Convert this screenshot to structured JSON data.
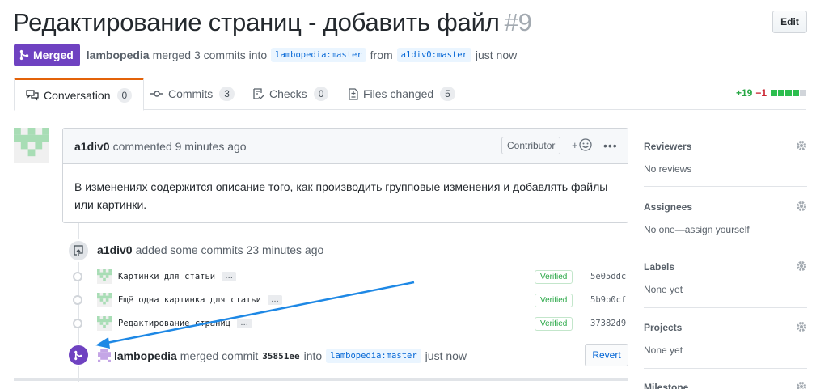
{
  "pr": {
    "title": "Редактирование страниц - добавить файл",
    "number": "#9",
    "edit_label": "Edit",
    "state_label": "Merged",
    "author": "lambopedia",
    "merge_text": "merged 3 commits into",
    "base_branch": "lambopedia:master",
    "from_text": "from",
    "head_branch": "a1div0:master",
    "time_text": "just now"
  },
  "tabs": [
    {
      "label": "Conversation",
      "count": "0"
    },
    {
      "label": "Commits",
      "count": "3"
    },
    {
      "label": "Checks",
      "count": "0"
    },
    {
      "label": "Files changed",
      "count": "5"
    }
  ],
  "diffstat": {
    "additions": "+19",
    "deletions": "−1"
  },
  "comment": {
    "author": "a1div0",
    "action": "commented 9 minutes ago",
    "badge": "Contributor",
    "body": "В изменениях содержится описание того, как производить групповые изменения и добавлять файлы или картинки."
  },
  "push_event": {
    "author": "a1div0",
    "text": "added some commits 23 minutes ago"
  },
  "commits": [
    {
      "message": "Картинки для статьи",
      "verified": "Verified",
      "sha": "5e05ddc"
    },
    {
      "message": "Ещё одна картинка для статьи",
      "verified": "Verified",
      "sha": "5b9b0cf"
    },
    {
      "message": "Редактирование страниц",
      "verified": "Verified",
      "sha": "37382d9"
    }
  ],
  "merge_event": {
    "author": "lambopedia",
    "text": "merged commit",
    "sha": "35851ee",
    "into": "into",
    "branch": "lambopedia:master",
    "time": "just now",
    "revert_label": "Revert"
  },
  "sidebar": {
    "reviewers": {
      "title": "Reviewers",
      "value": "No reviews"
    },
    "assignees": {
      "title": "Assignees",
      "value": "No one—assign yourself"
    },
    "labels": {
      "title": "Labels",
      "value": "None yet"
    },
    "projects": {
      "title": "Projects",
      "value": "None yet"
    },
    "milestone": {
      "title": "Milestone"
    }
  },
  "colors": {
    "merged": "#6f42c1",
    "active_tab": "#e36209",
    "link": "#0366d6",
    "additions": "#28a745",
    "deletions": "#cb2431"
  }
}
